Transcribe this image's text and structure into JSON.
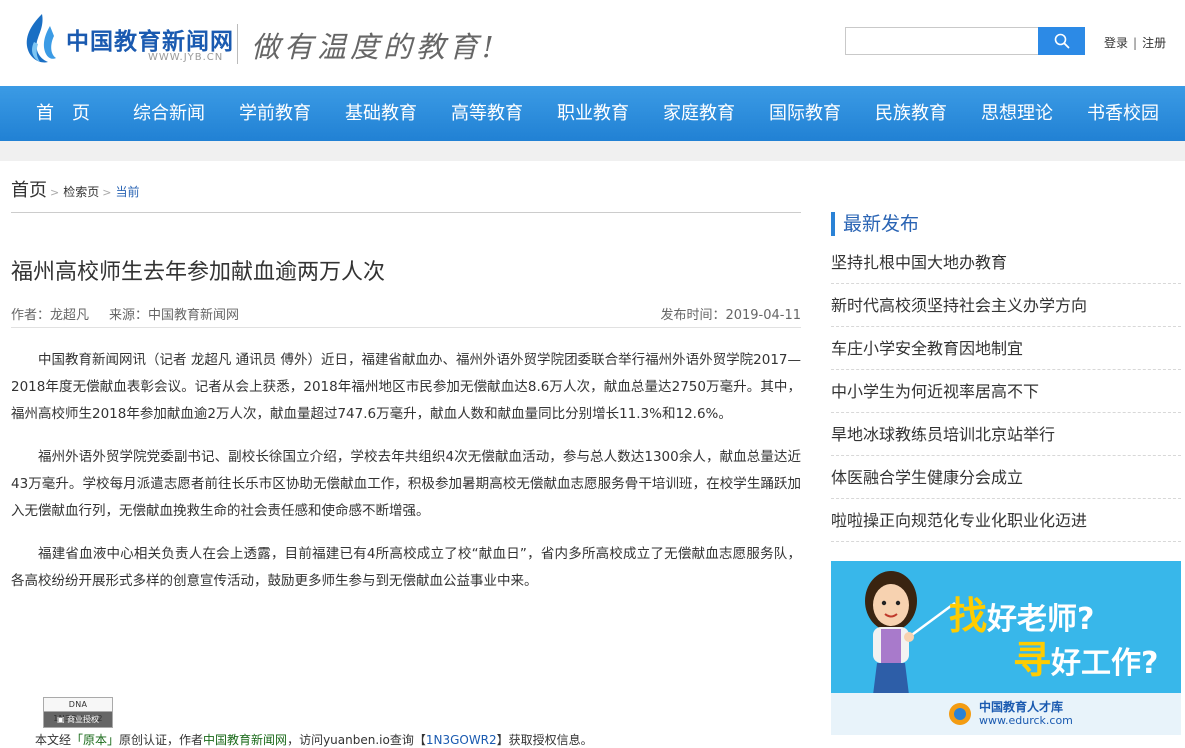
{
  "header": {
    "site_name": "中国教育新闻网",
    "site_url": "WWW.JYB.CN",
    "slogan": "做有温度的教育!",
    "search_placeholder": "",
    "login": "登录",
    "separator": "|",
    "register": "注册"
  },
  "nav": {
    "items": [
      "首　页",
      "综合新闻",
      "学前教育",
      "基础教育",
      "高等教育",
      "职业教育",
      "家庭教育",
      "国际教育",
      "民族教育",
      "思想理论",
      "书香校园"
    ]
  },
  "breadcrumb": {
    "home": "首页",
    "search": "检索页",
    "current": "当前"
  },
  "article": {
    "title": "福州高校师生去年参加献血逾两万人次",
    "author": "作者：龙超凡",
    "source": "来源：中国教育新闻网",
    "date": "发布时间：2019-04-11",
    "paragraphs": [
      "中国教育新闻网讯（记者 龙超凡 通讯员 傅外）近日，福建省献血办、福州外语外贸学院团委联合举行福州外语外贸学院2017—2018年度无偿献血表彰会议。记者从会上获悉，2018年福州地区市民参加无偿献血达8.6万人次，献血总量达2750万毫升。其中，福州高校师生2018年参加献血逾2万人次，献血量超过747.6万毫升，献血人数和献血量同比分别增长11.3%和12.6%。",
      "福州外语外贸学院党委副书记、副校长徐国立介绍，学校去年共组织4次无偿献血活动，参与总人数达1300余人，献血总量达近43万毫升。学校每月派遣志愿者前往长乐市区协助无偿献血工作，积极参加暑期高校无偿献血志愿服务骨干培训班，在校学生踊跃加入无偿献血行列，无偿献血挽救生命的社会责任感和使命感不断增强。",
      "福建省血液中心相关负责人在会上透露，目前福建已有4所高校成立了校“献血日”，省内多所高校成立了无偿献血志愿服务队，各高校纷纷开展形式多样的创意宣传活动，鼓励更多师生参与到无偿献血公益事业中来。"
    ]
  },
  "dna": {
    "code": "DNA 1N3GOWR2",
    "label": "商业授权"
  },
  "credit": {
    "prefix": "本文经",
    "original": "「原本」",
    "mid1": "原创认证，作者",
    "author": "中国教育新闻网",
    "mid2": "，访问yuanben.io查询【",
    "code": "1N3GOWR2",
    "suffix": "】获取授权信息。"
  },
  "sidebar": {
    "title": "最新发布",
    "items": [
      "坚持扎根中国大地办教育",
      "新时代高校须坚持社会主义办学方向",
      "车庄小学安全教育因地制宜",
      "中小学生为何近视率居高不下",
      "旱地冰球教练员培训北京站举行",
      "体医融合学生健康分会成立",
      "啦啦操正向规范化专业化职业化迈进"
    ]
  },
  "ad": {
    "char1": "找",
    "text1": "好老师?",
    "char2": "寻",
    "text2": "好工作?",
    "logo_name": "中国教育人才库",
    "logo_url": "www.edurck.com"
  },
  "colors": {
    "nav_blue": "#2a8ad9",
    "link_blue": "#2a64b4",
    "ad_blue": "#38b7ea"
  }
}
